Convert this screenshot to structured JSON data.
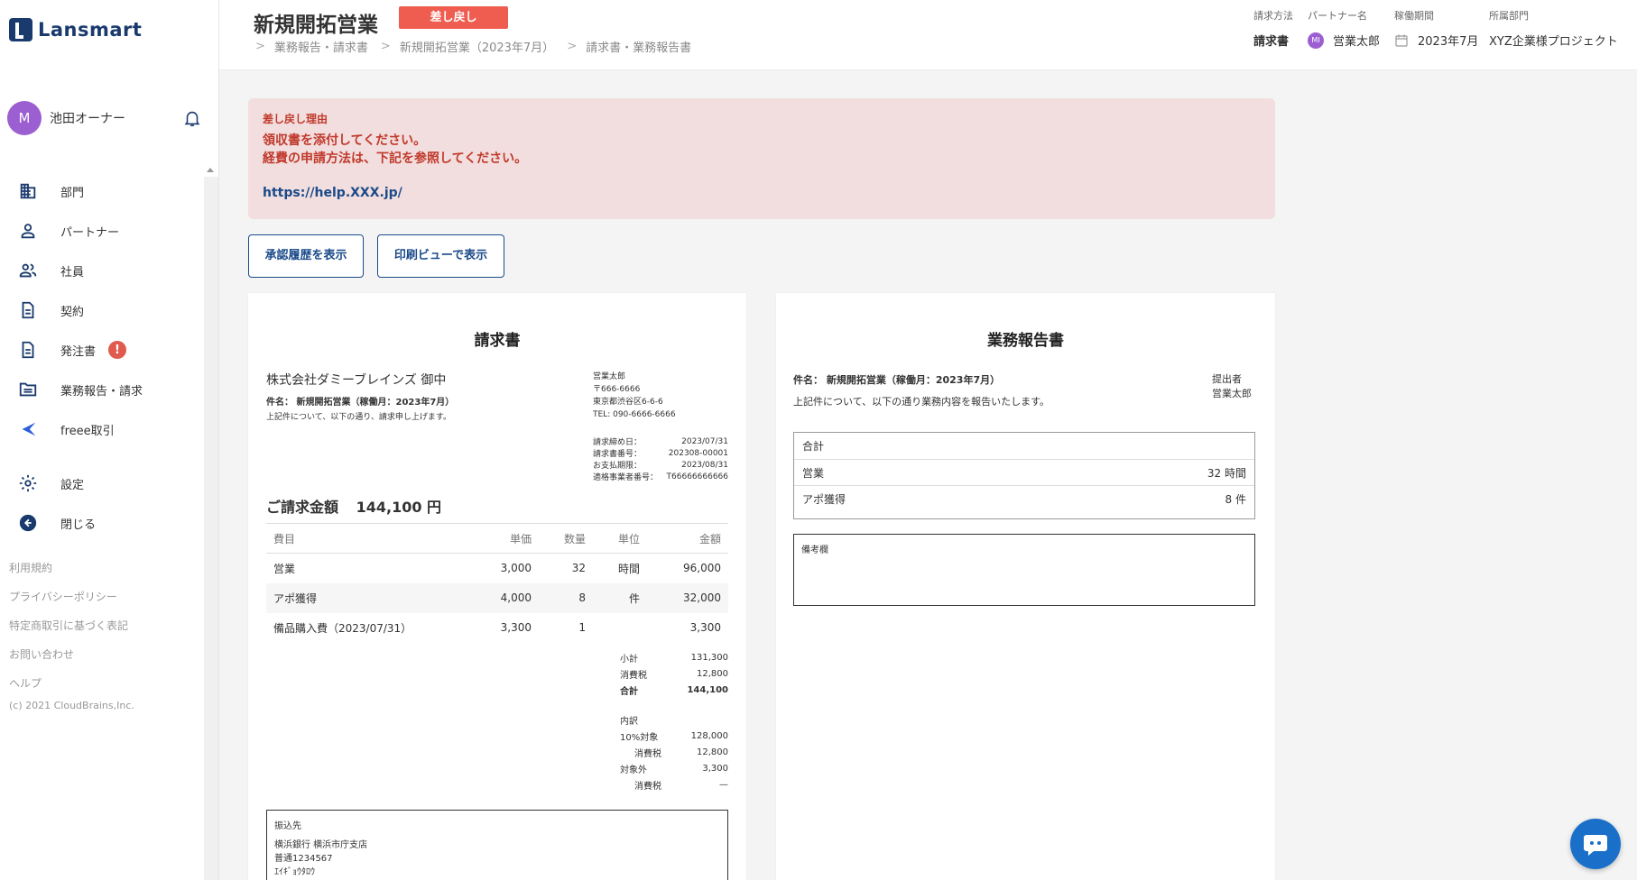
{
  "app": {
    "logo_text": "Lansmart"
  },
  "user": {
    "avatar_initial": "M",
    "name": "池田オーナー"
  },
  "sidebar": {
    "items": [
      {
        "label": "部門",
        "icon": "building-icon"
      },
      {
        "label": "パートナー",
        "icon": "person-icon"
      },
      {
        "label": "社員",
        "icon": "people-icon"
      },
      {
        "label": "契約",
        "icon": "document-icon"
      },
      {
        "label": "発注書",
        "icon": "document-icon",
        "badge": "!"
      },
      {
        "label": "業務報告・請求",
        "icon": "folder-icon"
      },
      {
        "label": "freee取引",
        "icon": "freee-icon"
      },
      {
        "label": "設定",
        "icon": "gear-icon"
      },
      {
        "label": "閉じる",
        "icon": "back-circle-icon"
      }
    ],
    "footer_links": [
      "利用規約",
      "プライバシーポリシー",
      "特定商取引に基づく表記",
      "お問い合わせ",
      "ヘルプ"
    ],
    "copyright": "(c) 2021 CloudBrains,Inc."
  },
  "header": {
    "title": "新規開拓営業",
    "status": "差し戻し",
    "breadcrumb": [
      "業務報告・請求書",
      "新規開拓営業（2023年7月）",
      "請求書・業務報告書"
    ],
    "meta": {
      "billing_method_label": "請求方法",
      "billing_method": "請求書",
      "partner_label": "パートナー名",
      "partner_initial": "MI",
      "partner": "営業太郎",
      "period_label": "稼働期間",
      "period": "2023年7月",
      "department_label": "所属部門",
      "department": "XYZ企業様プロジェクト"
    }
  },
  "reason": {
    "title": "差し戻し理由",
    "line1": "領収書を添付してください。",
    "line2": "経費の申請方法は、下記を参照してください。",
    "link": "https://help.XXX.jp/"
  },
  "buttons": {
    "history": "承認履歴を表示",
    "print": "印刷ビューで表示"
  },
  "invoice": {
    "title": "請求書",
    "client": "株式会社ダミーブレインズ 御中",
    "subject": "件名： 新規開拓営業（稼働月：2023年7月）",
    "intro": "上記件について、以下の通り、請求申し上げます。",
    "sender": [
      "営業太郎",
      "〒666-6666",
      "東京都渋谷区6-6-6",
      "TEL: 090-6666-6666"
    ],
    "details": [
      {
        "k": "請求締め日：",
        "v": "2023/07/31"
      },
      {
        "k": "請求書番号：",
        "v": "202308-00001"
      },
      {
        "k": "お支払期限：",
        "v": "2023/08/31"
      },
      {
        "k": "適格事業者番号：",
        "v": "T66666666666"
      }
    ],
    "amount_label": "ご請求金額",
    "amount": "144,100 円",
    "columns": [
      "費目",
      "単価",
      "数量",
      "単位",
      "金額"
    ],
    "rows": [
      {
        "item": "営業",
        "price": "3,000",
        "qty": "32",
        "unit": "時間",
        "amount": "96,000"
      },
      {
        "item": "アポ獲得",
        "price": "4,000",
        "qty": "8",
        "unit": "件",
        "amount": "32,000"
      },
      {
        "item": "備品購入費（2023/07/31）",
        "price": "3,300",
        "qty": "1",
        "unit": "",
        "amount": "3,300"
      }
    ],
    "summary": {
      "subtotal_label": "小計",
      "subtotal": "131,300",
      "tax_label": "消費税",
      "tax": "12,800",
      "total_label": "合計",
      "total": "144,100",
      "breakdown_label": "内訳",
      "b1_label": "10%対象",
      "b1": "128,000",
      "b1_tax_label": "消費税",
      "b1_tax": "12,800",
      "b2_label": "対象外",
      "b2": "3,300",
      "b2_tax_label": "消費税",
      "b2_tax": "—"
    },
    "bank": {
      "label": "振込先",
      "line1": "横浜銀行 横浜市庁支店",
      "line2": "普通1234567",
      "line3": "ｴｲｷﾞｮｳﾀﾛｳ"
    }
  },
  "report": {
    "title": "業務報告書",
    "subject": "件名： 新規開拓営業（稼働月：2023年7月）",
    "intro": "上記件について、以下の通り業務内容を報告いたします。",
    "submitter_label": "提出者",
    "submitter": "営業太郎",
    "total_label": "合計",
    "rows": [
      {
        "label": "営業",
        "value": "32 時間"
      },
      {
        "label": "アポ獲得",
        "value": "8 件"
      }
    ],
    "memo_label": "備考欄"
  },
  "colors": {
    "accent": "#1a4a8a",
    "danger": "#ee5d4f",
    "avatar": "#9c5fd1"
  }
}
